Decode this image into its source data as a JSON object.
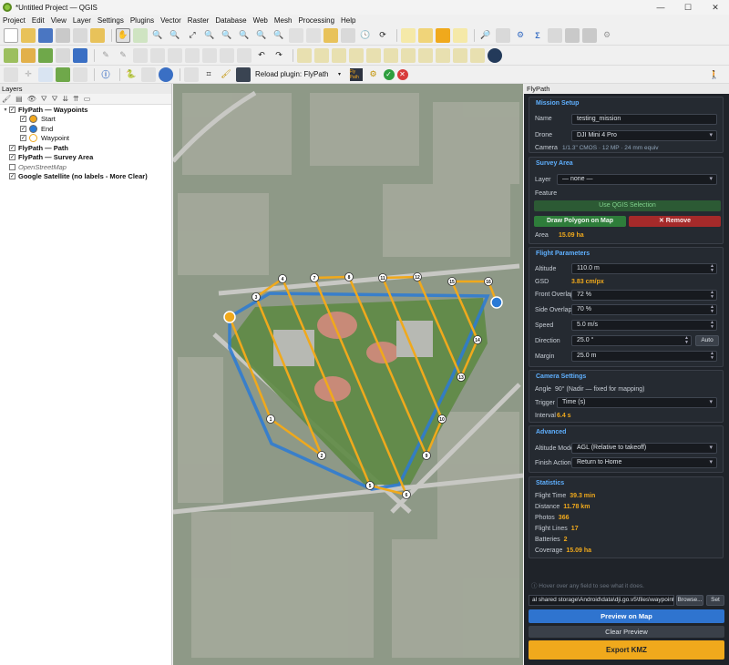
{
  "window": {
    "title": "*Untitled Project — QGIS",
    "controls": [
      "—",
      "☐",
      "✕"
    ]
  },
  "menu": [
    "Project",
    "Edit",
    "View",
    "Layer",
    "Settings",
    "Plugins",
    "Vector",
    "Raster",
    "Database",
    "Web",
    "Mesh",
    "Processing",
    "Help"
  ],
  "toolbar3": {
    "reload_label": "Reload plugin: FlyPath",
    "fp_text": "Fly Path"
  },
  "layers_panel": {
    "title": "Layers",
    "items": [
      {
        "label": "FlyPath — Waypoints",
        "checked": true,
        "bold": true,
        "level": 0
      },
      {
        "label": "Start",
        "checked": true,
        "level": 1,
        "color": "#f2a81d"
      },
      {
        "label": "End",
        "checked": true,
        "level": 1,
        "color": "#2a7ad6"
      },
      {
        "label": "Waypoint",
        "checked": true,
        "level": 1,
        "color": "#ffffff"
      },
      {
        "label": "FlyPath — Path",
        "checked": true,
        "bold": true,
        "level": 0
      },
      {
        "label": "FlyPath — Survey Area",
        "checked": true,
        "bold": true,
        "level": 0
      },
      {
        "label": "OpenStreetMap",
        "checked": false,
        "italic": true,
        "level": 0
      },
      {
        "label": "Google Satellite (no labels - More Clear)",
        "checked": true,
        "bold": true,
        "level": 0
      }
    ]
  },
  "map": {
    "waypoint_labels": [
      "1",
      "2",
      "3",
      "4",
      "5",
      "6",
      "7",
      "8",
      "9",
      "10",
      "11",
      "12",
      "13",
      "14",
      "15",
      "16",
      "17"
    ],
    "colors": {
      "path": "#f0a91c",
      "area": "#2a7ad6",
      "start": "#f0a91c",
      "end": "#2a7ad6"
    }
  },
  "dock": {
    "title": "FlyPath",
    "mission": {
      "title": "Mission Setup",
      "name_label": "Name",
      "name_value": "testing_mission",
      "drone_label": "Drone",
      "drone_value": "DJI Mini 4 Pro",
      "camera_label": "Camera",
      "camera_value": "1/1.3\" CMOS · 12 MP · 24 mm equiv"
    },
    "survey": {
      "title": "Survey Area",
      "layer_label": "Layer",
      "layer_value": "— none —",
      "feature_label": "Feature",
      "use_selection": "Use QGIS Selection",
      "draw_polygon": "Draw Polygon on Map",
      "remove": "✕ Remove",
      "area_label": "Area",
      "area_value": "15.09 ha"
    },
    "flight": {
      "title": "Flight Parameters",
      "altitude_label": "Altitude",
      "altitude_value": "110.0 m",
      "gsd_label": "GSD",
      "gsd_value": "3.83 cm/px",
      "front_label": "Front Overlap",
      "front_value": "72 %",
      "side_label": "Side Overlap",
      "side_value": "70 %",
      "speed_label": "Speed",
      "speed_value": "5.0 m/s",
      "direction_label": "Direction",
      "direction_value": "25.0 °",
      "auto_label": "Auto",
      "margin_label": "Margin",
      "margin_value": "25.0 m"
    },
    "camera": {
      "title": "Camera Settings",
      "angle_label": "Angle",
      "angle_value": "90° (Nadir — fixed for mapping)",
      "trigger_label": "Trigger",
      "trigger_value": "Time (s)",
      "interval_label": "Interval",
      "interval_value": "6.4 s"
    },
    "advanced": {
      "title": "Advanced",
      "alt_mode_label": "Altitude Mode",
      "alt_mode_value": "AGL (Relative to takeoff)",
      "finish_label": "Finish Action",
      "finish_value": "Return to Home"
    },
    "stats": {
      "title": "Statistics",
      "rows": [
        {
          "label": "Flight Time",
          "value": "39.3 min"
        },
        {
          "label": "Distance",
          "value": "11.78 km"
        },
        {
          "label": "Photos",
          "value": "366"
        },
        {
          "label": "Flight Lines",
          "value": "17"
        },
        {
          "label": "Batteries",
          "value": "2"
        },
        {
          "label": "Coverage",
          "value": "15.09 ha"
        }
      ]
    },
    "hint": "ⓘ Hover over any field to see what it does.",
    "output_path": "al shared storage\\Android\\data\\dji.go.v5\\files\\waypoint",
    "browse": "Browse...",
    "set": "Set",
    "preview": "Preview on Map",
    "clear": "Clear Preview",
    "export": "Export KMZ"
  }
}
